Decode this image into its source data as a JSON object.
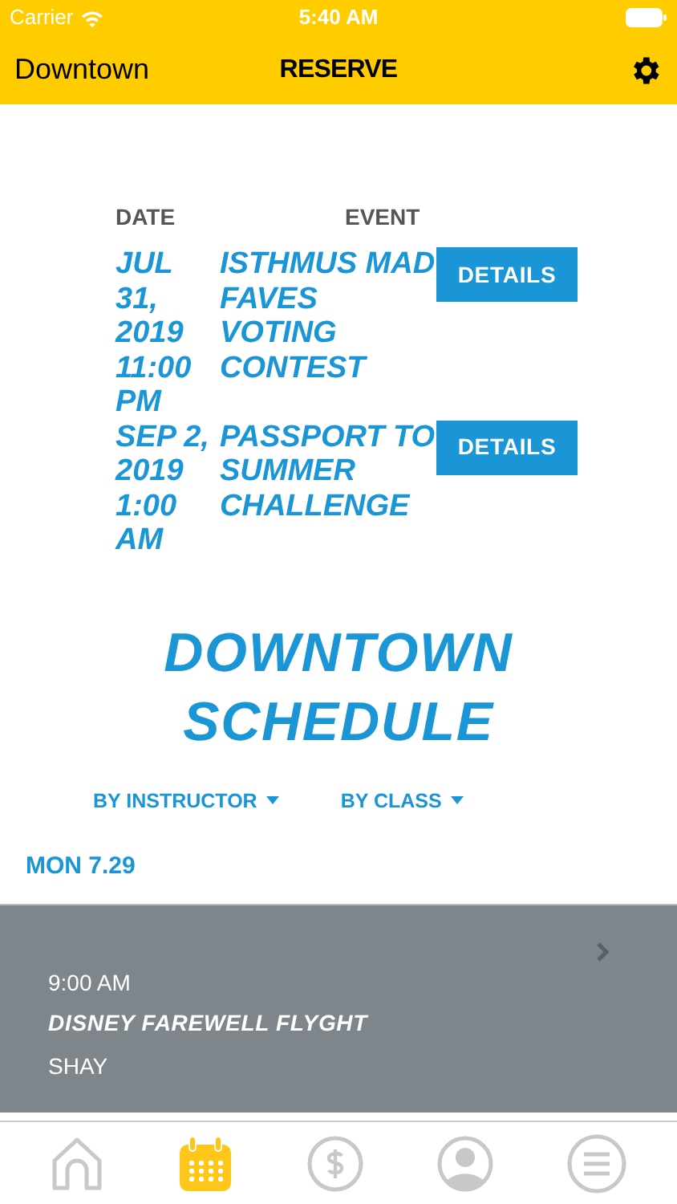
{
  "status_bar": {
    "carrier": "Carrier",
    "time": "5:40 AM"
  },
  "nav_bar": {
    "location": "Downtown",
    "title": "RESERVE"
  },
  "events_table": {
    "columns": [
      "DATE",
      "EVENT"
    ],
    "rows": [
      {
        "date": "JUL 31, 2019 11:00 PM",
        "event": "ISTHMUS MAD FAVES VOTING CONTEST",
        "button": "DETAILS"
      },
      {
        "date": "SEP 2, 2019 1:00 AM",
        "event": "PASSPORT TO SUMMER CHALLENGE",
        "button": "DETAILS"
      }
    ]
  },
  "schedule_title": "DOWNTOWN SCHEDULE",
  "filters": [
    "BY INSTRUCTOR",
    "BY CLASS"
  ],
  "day": "MON 7.29",
  "classes": [
    {
      "time": "9:00 AM",
      "name": "DISNEY FAREWELL FLYGHT",
      "instructor": "SHAY"
    }
  ],
  "tab_bar": [
    {
      "kind": "home",
      "selected": false
    },
    {
      "kind": "calendar",
      "selected": true
    },
    {
      "kind": "dollar",
      "selected": false
    },
    {
      "kind": "profile",
      "selected": false
    },
    {
      "kind": "menu",
      "selected": false
    }
  ]
}
